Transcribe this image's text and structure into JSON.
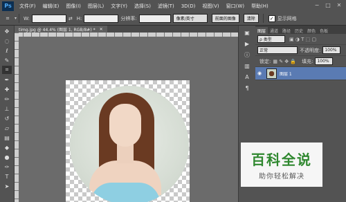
{
  "app": {
    "logo": "Ps"
  },
  "menu": [
    "文件(F)",
    "编辑(E)",
    "图像(I)",
    "图层(L)",
    "文字(Y)",
    "选择(S)",
    "滤镜(T)",
    "3D(D)",
    "视图(V)",
    "窗口(W)",
    "帮助(H)"
  ],
  "window_controls": [
    "−",
    "□",
    "✕"
  ],
  "options": {
    "w_label": "W:",
    "h_label": "H:",
    "resolution_label": "分辨率:",
    "unit_value": "像素/英寸",
    "front_image_button": "前面的图像",
    "clear_button": "清除",
    "show_grid_label": "显示网格",
    "show_grid_checked": "✓"
  },
  "document": {
    "tab_title": "timg.jpg @ 44.4% (图层 1, RGB/8#) *",
    "close_icon": "✕"
  },
  "layers_panel": {
    "tabs": [
      "图层",
      "通道",
      "路径",
      "历史",
      "颜色",
      "色板"
    ],
    "kind_label": "ρ 类型",
    "blend_mode": "正常",
    "opacity_label": "不透明度:",
    "opacity_value": "100%",
    "lock_label": "锁定:",
    "fill_label": "填充:",
    "fill_value": "100%",
    "layer_name": "图层 1"
  },
  "watermark": {
    "title": "百科全说",
    "subtitle": "助你轻松解决"
  }
}
